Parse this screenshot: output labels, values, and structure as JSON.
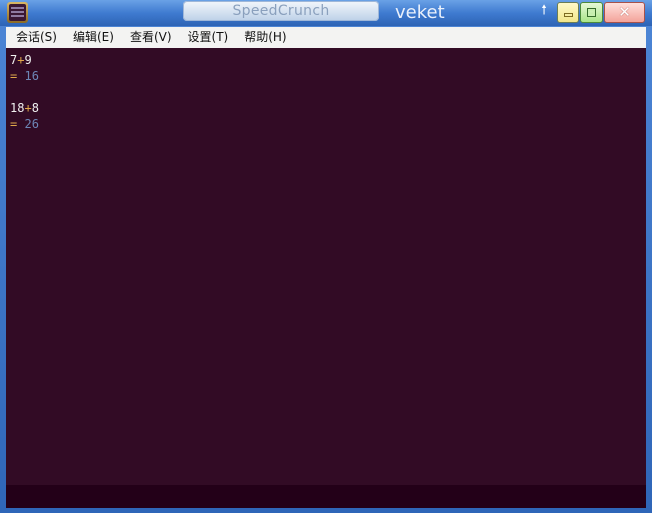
{
  "window": {
    "title": "SpeedCrunch",
    "host": "veket",
    "close_glyph": "✕",
    "up_glyph": "🠕",
    "icons": {
      "app": "speedcrunch-app-icon",
      "up": "up-arrow-icon",
      "minimize": "minimize-icon",
      "maximize": "maximize-icon",
      "close": "close-icon"
    }
  },
  "menu": {
    "items": [
      {
        "label": "会话(S)"
      },
      {
        "label": "编辑(E)"
      },
      {
        "label": "查看(V)"
      },
      {
        "label": "设置(T)"
      },
      {
        "label": "帮助(H)"
      }
    ]
  },
  "history": [
    {
      "lhs": "7",
      "op": "+",
      "rhs": "9",
      "eq": "=",
      "result": "16"
    },
    {
      "lhs": "18",
      "op": "+",
      "rhs": "8",
      "eq": "=",
      "result": "26"
    }
  ],
  "editor": {
    "value": ""
  },
  "colors": {
    "display_bg": "#320b25",
    "editor_bg": "#230018",
    "number": "#f0f0f0",
    "operator": "#e0a84a",
    "result": "#6d86b6"
  }
}
